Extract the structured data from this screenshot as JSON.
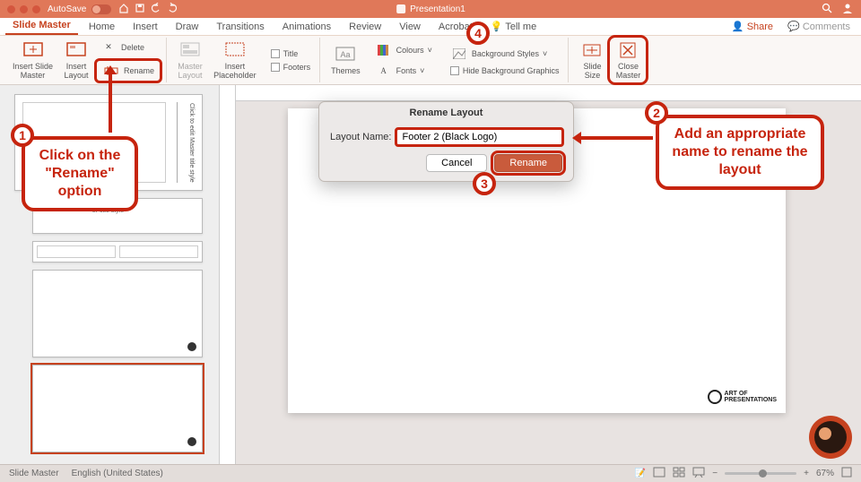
{
  "titlebar": {
    "autosave": "AutoSave",
    "doc": "Presentation1"
  },
  "tabs": {
    "items": [
      "Slide Master",
      "Home",
      "Insert",
      "Draw",
      "Transitions",
      "Animations",
      "Review",
      "View",
      "Acrobat",
      "Tell me"
    ],
    "share": "Share",
    "comments": "Comments",
    "tellme_icon_label": "💡"
  },
  "ribbon": {
    "insert_slide_master": "Insert Slide\nMaster",
    "insert_layout": "Insert\nLayout",
    "delete": "Delete",
    "rename": "Rename",
    "master_layout": "Master\nLayout",
    "insert_placeholder": "Insert\nPlaceholder",
    "title": "Title",
    "footers": "Footers",
    "themes": "Themes",
    "colours": "Colours",
    "fonts": "Fonts",
    "bg_styles": "Background Styles",
    "hide_bg": "Hide Background Graphics",
    "slide_size": "Slide\nSize",
    "close_master": "Close\nMaster"
  },
  "dialog": {
    "title": "Rename Layout",
    "label": "Layout Name:",
    "value": "Footer 2 (Black Logo)",
    "cancel": "Cancel",
    "rename": "Rename"
  },
  "callouts": {
    "c1": "Click on the\n\"Rename\"\noption",
    "c2": "Add an appropriate\nname to rename the\nlayout"
  },
  "thumbs": {
    "master_title": "Click to edit Master title style",
    "t2": "er title style"
  },
  "status": {
    "mode": "Slide Master",
    "lang": "English (United States)",
    "zoom": "67%"
  },
  "logo": {
    "text": "ART OF\nPRESENTATIONS"
  }
}
